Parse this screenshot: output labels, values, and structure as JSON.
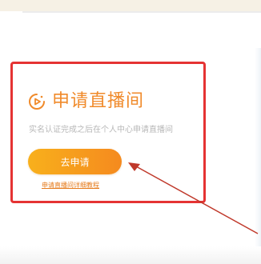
{
  "card": {
    "title": "申请直播间",
    "subtitle": "实名认证完成之后在个人中心申请直播间",
    "apply_button_label": "去申请",
    "tutorial_link": "申请直播间详细教程"
  },
  "colors": {
    "accent": "#f08a2a",
    "highlight_border": "#e53333",
    "arrow": "#c0392b"
  },
  "icons": {
    "title_icon": "live-broadcast-icon"
  }
}
